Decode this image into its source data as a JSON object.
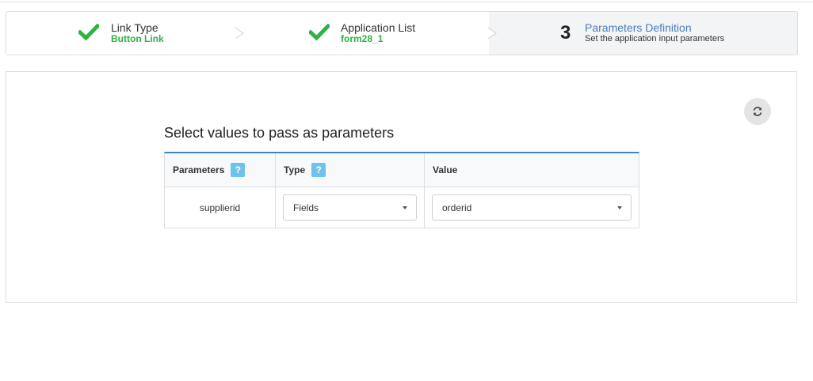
{
  "steps": [
    {
      "title": "Link Type",
      "subtitle": "Button Link",
      "state": "done"
    },
    {
      "title": "Application List",
      "subtitle": "form28_1",
      "state": "done"
    },
    {
      "number": "3",
      "title": "Parameters Definition",
      "description": "Set the application input parameters",
      "state": "active"
    }
  ],
  "colors": {
    "accent": "#3d87c7",
    "success": "#2fb344",
    "active_step_title": "#4a7ebb",
    "help_badge": "#6fc2ea"
  },
  "icons": {
    "done_step": "check-icon",
    "refresh": "refresh-icon",
    "help": "help-badge",
    "dropdown": "caret-down-icon"
  },
  "panel": {
    "title": "Select values to pass as parameters"
  },
  "table": {
    "headers": {
      "parameters": "Parameters",
      "type": "Type",
      "value": "Value",
      "help_mark": "?"
    },
    "rows": [
      {
        "parameter": "supplierid",
        "type": "Fields",
        "value": "orderid"
      }
    ]
  }
}
